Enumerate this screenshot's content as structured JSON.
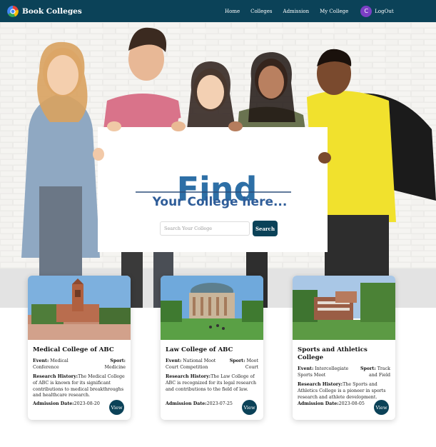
{
  "navbar": {
    "brand": "Book Colleges",
    "links": [
      "Home",
      "Colleges",
      "Admission",
      "My College"
    ],
    "avatar_letter": "C",
    "logout": "LogOut"
  },
  "hero": {
    "heading": "Find",
    "subheading": "Your College here...",
    "search_placeholder": "Search Your College",
    "search_button": "Search"
  },
  "cards": [
    {
      "title": "Medical College of ABC",
      "event_label": "Event:",
      "event": "Medical Conference",
      "sport_label": "Sport:",
      "sport": "Medicine",
      "history_label": "Research History:",
      "history": "The Medical College of ABC is known for its significant contributions to medical breakthroughs and healthcare research.",
      "admission_label": "Admission Date:",
      "admission_date": "2023-08-20",
      "button": "View"
    },
    {
      "title": "Law College of ABC",
      "event_label": "Event:",
      "event": "National Moot Court Competition",
      "sport_label": "Sport:",
      "sport": "Moot Court",
      "history_label": "Research History:",
      "history": "The Law College of ABC is recognized for its legal research and contributions to the field of law.",
      "admission_label": "Admission Date:",
      "admission_date": "2023-07-25",
      "button": "View"
    },
    {
      "title": "Sports and Athletics College",
      "event_label": "Event:",
      "event": "Intercollegiate Sports Meet",
      "sport_label": "Sport:",
      "sport": "Track and Field",
      "history_label": "Research History:",
      "history": "The Sports and Athletics College is a pioneer in sports research and athlete development.",
      "admission_label": "Admission Date:",
      "admission_date": "2023-08-05",
      "button": "View"
    }
  ],
  "colors": {
    "primary": "#0b4258",
    "avatar": "#7b3fc4",
    "heading_blue": "#2d6fa6",
    "subheading_blue": "#2f5d99"
  }
}
